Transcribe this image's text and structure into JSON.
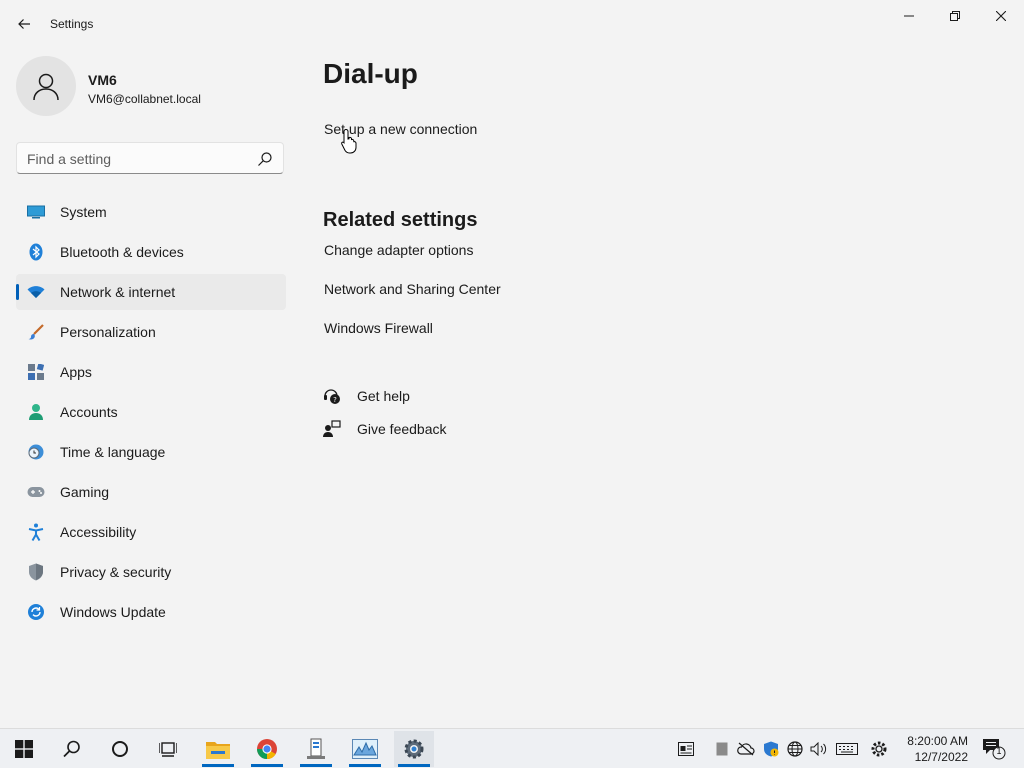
{
  "window": {
    "title": "Settings"
  },
  "profile": {
    "name": "VM6",
    "email": "VM6@collabnet.local"
  },
  "search": {
    "placeholder": "Find a setting"
  },
  "sidebar": {
    "items": [
      {
        "label": "System",
        "icon": "system-icon"
      },
      {
        "label": "Bluetooth & devices",
        "icon": "bluetooth-icon"
      },
      {
        "label": "Network & internet",
        "icon": "wifi-icon",
        "selected": true
      },
      {
        "label": "Personalization",
        "icon": "brush-icon"
      },
      {
        "label": "Apps",
        "icon": "apps-icon"
      },
      {
        "label": "Accounts",
        "icon": "accounts-icon"
      },
      {
        "label": "Time & language",
        "icon": "clock-globe-icon"
      },
      {
        "label": "Gaming",
        "icon": "controller-icon"
      },
      {
        "label": "Accessibility",
        "icon": "accessibility-icon"
      },
      {
        "label": "Privacy & security",
        "icon": "shield-icon"
      },
      {
        "label": "Windows Update",
        "icon": "update-icon"
      }
    ]
  },
  "main": {
    "title": "Dial-up",
    "setup_link": "Set up a new connection",
    "related_title": "Related settings",
    "related_links": [
      "Change adapter options",
      "Network and Sharing Center",
      "Windows Firewall"
    ],
    "help": {
      "get_help": "Get help",
      "give_feedback": "Give feedback"
    }
  },
  "taskbar": {
    "time": "8:20:00 AM",
    "date": "12/7/2022",
    "notification_count": "1",
    "apps": [
      "start-icon",
      "search-icon",
      "cortana-icon",
      "task-view-icon",
      "file-explorer-icon",
      "chrome-icon",
      "server-manager-icon",
      "performance-monitor-icon",
      "settings-icon"
    ]
  },
  "colors": {
    "accent": "#005fb8",
    "background": "#f3f3f3",
    "taskbar": "#eef0f3"
  }
}
